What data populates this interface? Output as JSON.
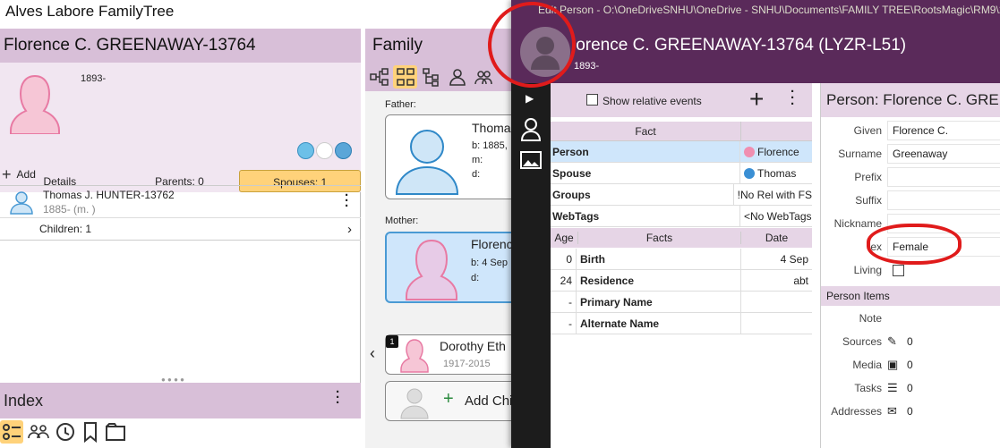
{
  "window": {
    "title": "Alves Labore FamilyTree"
  },
  "left": {
    "person_name": "Florence C. GREENAWAY-13764",
    "years": "1893-",
    "tabs": {
      "details": "Details",
      "parents": "Parents: 0",
      "spouses": "Spouses: 1"
    },
    "add_label": "Add",
    "spouse": {
      "name": "Thomas J. HUNTER-13762",
      "years": "1885- (m. )"
    },
    "children_label": "Children: 1"
  },
  "index": {
    "title": "Index"
  },
  "family": {
    "title": "Family",
    "father_label": "Father:",
    "father_name": "Thoma",
    "father_b": "b: 1885,",
    "father_m": "m:",
    "father_d": "d:",
    "mother_label": "Mother:",
    "mother_name": "Florenc",
    "mother_b": "b: 4 Sep",
    "mother_d": "d:",
    "child_badge": "1",
    "child_name": "Dorothy Eth",
    "child_years": "1917-2015",
    "add_child": "Add Chi"
  },
  "dialog": {
    "title": "Edit Person - O:\\OneDriveSNHU\\OneDrive - SNHU\\Documents\\FAMILY TREE\\RootsMagic\\RM9\\20",
    "header_name": "lorence C. GREENAWAY-13764 (LYZR-L51)",
    "header_years": "1893-",
    "show_relative": "Show relative events",
    "fact_col": "Fact",
    "fact_rows": [
      {
        "fact": "Person",
        "value": "Florence"
      },
      {
        "fact": "Spouse",
        "value": "Thomas"
      },
      {
        "fact": "Groups",
        "value": "!No Rel with FS"
      },
      {
        "fact": "WebTags",
        "value": "<No WebTags"
      }
    ],
    "event_headers": {
      "age": "Age",
      "facts": "Facts",
      "date": "Date"
    },
    "events": [
      {
        "age": "0",
        "fact": "Birth",
        "date": "4 Sep"
      },
      {
        "age": "24",
        "fact": "Residence",
        "date": "abt"
      },
      {
        "age": "-",
        "fact": "Primary Name",
        "date": ""
      },
      {
        "age": "-",
        "fact": "Alternate Name",
        "date": ""
      }
    ],
    "person_panel": {
      "title": "Person: Florence C. GREE",
      "given_label": "Given",
      "given": "Florence C.",
      "surname_label": "Surname",
      "surname": "Greenaway",
      "prefix_label": "Prefix",
      "suffix_label": "Suffix",
      "nickname_label": "Nickname",
      "sex_label": "ex",
      "sex": "Female",
      "living_label": "Living",
      "items_title": "Person Items",
      "note_label": "Note",
      "sources_label": "Sources",
      "sources": "0",
      "media_label": "Media",
      "media": "0",
      "tasks_label": "Tasks",
      "tasks": "0",
      "addresses_label": "Addresses",
      "addresses": "0"
    }
  },
  "colors": {
    "accent": "#5a2a5a",
    "lilac": "#d8bfd8",
    "highlight": "#ffd27a",
    "annotation": "#e01b1b"
  }
}
